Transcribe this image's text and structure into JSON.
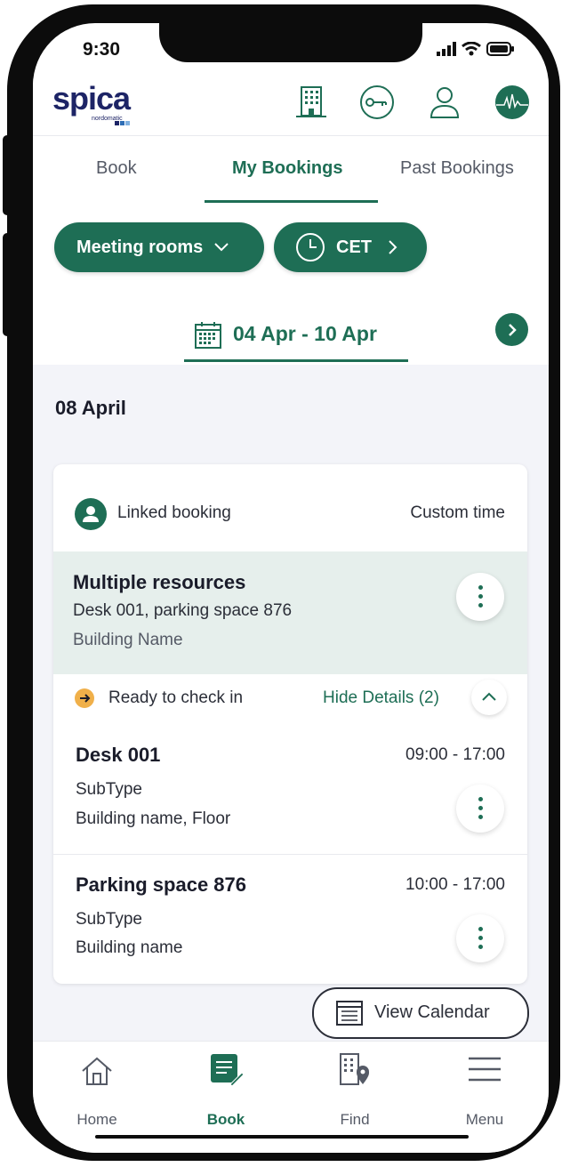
{
  "status_bar": {
    "time": "9:30"
  },
  "brand": {
    "name": "spica",
    "sub": "nordomatic",
    "accent": "#1e6e55",
    "navy": "#1d2466"
  },
  "header_icons": [
    "building-icon",
    "key-icon",
    "user-icon",
    "avatar-icon"
  ],
  "tabs": [
    {
      "label": "Book",
      "active": false
    },
    {
      "label": "My Bookings",
      "active": true
    },
    {
      "label": "Past Bookings",
      "active": false
    }
  ],
  "filters": {
    "resource_type": "Meeting rooms",
    "timezone": "CET"
  },
  "date_range": {
    "label": "04 Apr - 10 Apr"
  },
  "day": {
    "label": "08 April"
  },
  "booking": {
    "linked_label": "Linked booking",
    "time_type": "Custom time",
    "title": "Multiple resources",
    "resources": "Desk 001, parking space 876",
    "building": "Building Name",
    "status": "Ready to check in",
    "toggle_details": "Hide Details (2)",
    "items": [
      {
        "name": "Desk 001",
        "time": "09:00 - 17:00",
        "subtype": "SubType",
        "location": "Building name, Floor"
      },
      {
        "name": "Parking space 876",
        "time": "10:00 - 17:00",
        "subtype": "SubType",
        "location": "Building name"
      }
    ]
  },
  "view_calendar": {
    "label": "View Calendar"
  },
  "bottom_nav": [
    {
      "label": "Home",
      "icon": "home-icon",
      "active": false
    },
    {
      "label": "Book",
      "icon": "book-icon",
      "active": true
    },
    {
      "label": "Find",
      "icon": "find-icon",
      "active": false
    },
    {
      "label": "Menu",
      "icon": "menu-icon",
      "active": false
    }
  ]
}
